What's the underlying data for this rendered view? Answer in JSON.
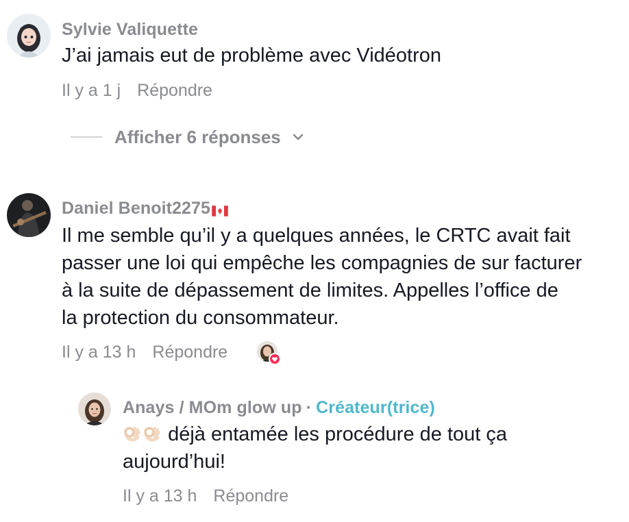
{
  "comments": [
    {
      "username": "Sylvie Valiquette",
      "text": "J’ai jamais eut de problème avec Vidéotron",
      "time": "Il y a 1 j",
      "reply_label": "Répondre",
      "show_replies": "Afficher 6 réponses"
    },
    {
      "username": "Daniel Benoit2275",
      "flag": "canada-flag-icon",
      "text_lines": [
        "Il me semble qu’il y a quelques années, le CRTC avait fait",
        "passer une loi qui empêche les compagnies de sur facturer",
        "à la suite de dépassement de limites. Appelles l’office de",
        "la protection du consommateur."
      ],
      "time": "Il y a 13 h",
      "reply_label": "Répondre",
      "liked_by_creator_icon": "creator-heart-avatar-icon"
    }
  ],
  "reply": {
    "username": "Anays / MOm glow up",
    "separator": "·",
    "badge": "Créateur(trice)",
    "emoji": "ok-hand-icon",
    "text_lines": [
      "déjà entamée les procédure de tout ça",
      "aujourd’hui!"
    ],
    "time": "Il y a 13 h",
    "reply_label": "Répondre"
  },
  "colors": {
    "meta_gray": "#8a8b91",
    "text": "#161823",
    "creator_badge": "#4fb8cc",
    "like_heart": "#fe2c55"
  }
}
